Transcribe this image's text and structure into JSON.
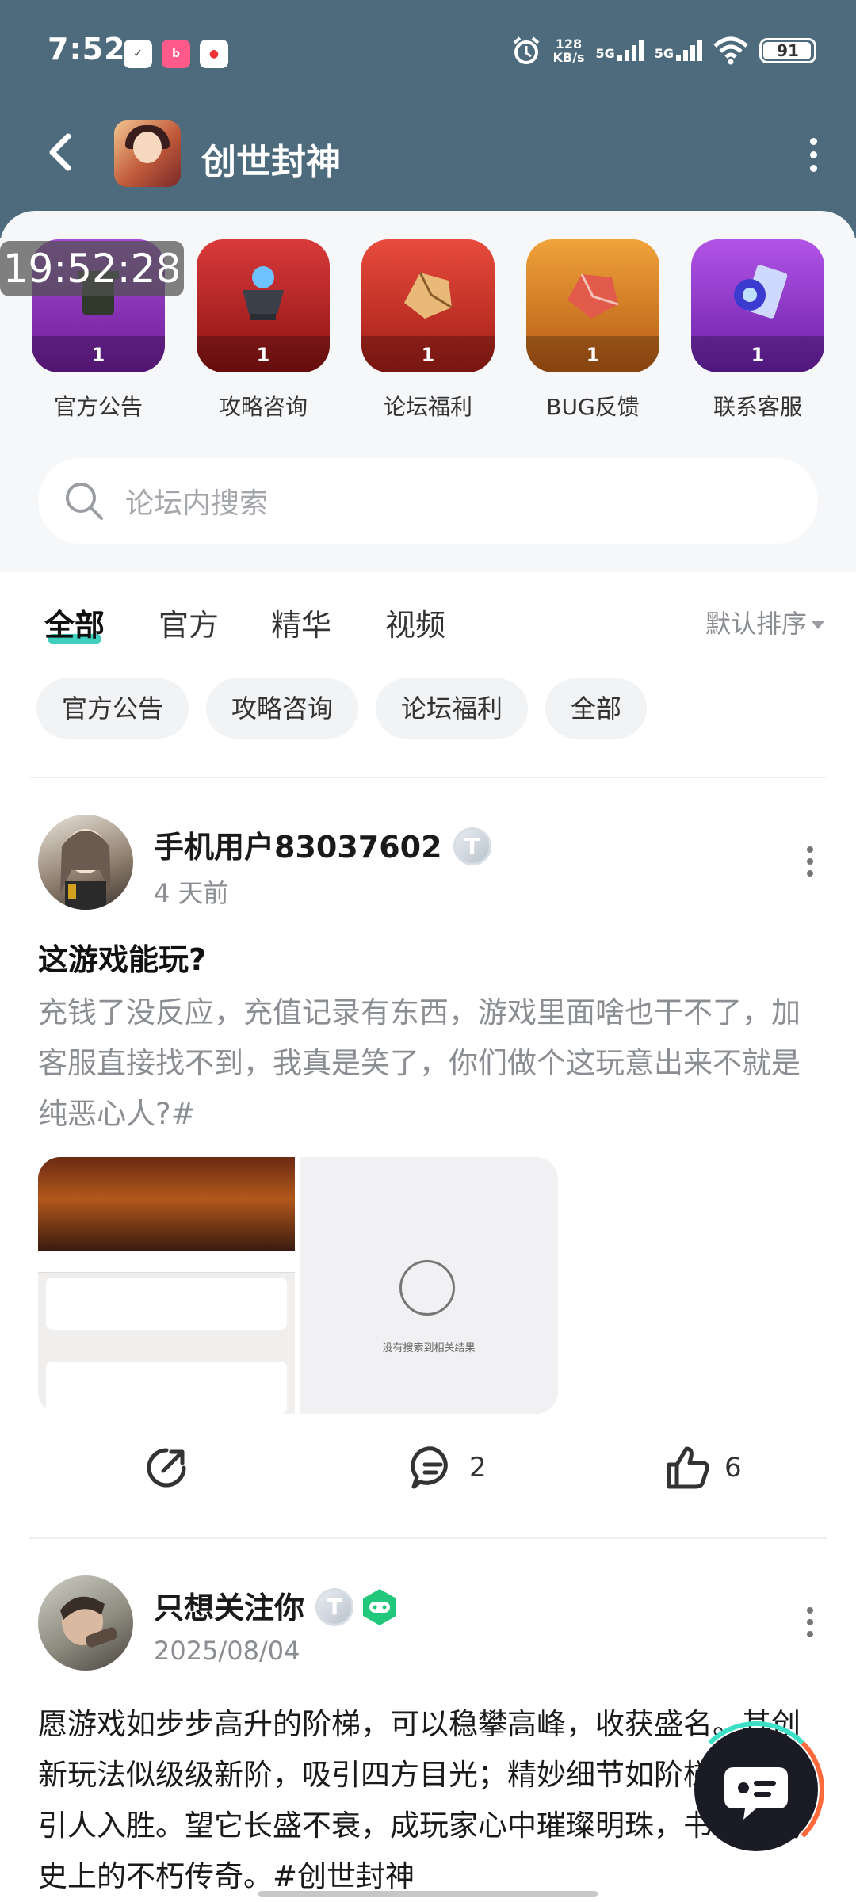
{
  "status_bar": {
    "time": "7:52",
    "net_speed_value": "128",
    "net_speed_unit": "KB/s",
    "signal1": "5G",
    "signal2": "5G",
    "battery": "91"
  },
  "nav": {
    "title": "创世封神"
  },
  "timestamp_overlay": "19:52:28",
  "shortcuts": [
    {
      "label": "官方公告",
      "count": "1"
    },
    {
      "label": "攻略咨询",
      "count": "1"
    },
    {
      "label": "论坛福利",
      "count": "1"
    },
    {
      "label": "BUG反馈",
      "count": "1"
    },
    {
      "label": "联系客服",
      "count": "1"
    }
  ],
  "search": {
    "placeholder": "论坛内搜索"
  },
  "tabs": [
    {
      "label": "全部",
      "active": true
    },
    {
      "label": "官方"
    },
    {
      "label": "精华"
    },
    {
      "label": "视频"
    }
  ],
  "sort_label": "默认排序",
  "chips": [
    "官方公告",
    "攻略咨询",
    "论坛福利",
    "全部"
  ],
  "posts": [
    {
      "username": "手机用户83037602",
      "time": "4 天前",
      "title": "这游戏能玩?",
      "body": "充钱了没反应，充值记录有东西，游戏里面啥也干不了，加客服直接找不到，我真是笑了，你们做个这玩意出来不就是纯恶心人?#",
      "image_b_text": "没有搜索到相关结果",
      "comments": "2",
      "likes": "6"
    },
    {
      "username": "只想关注你",
      "time": "2025/08/04",
      "body": "愿游戏如步步高升的阶梯，可以稳攀高峰，收获盛名。其创新玩法似级级新阶，吸引四方目光；精妙细节如阶梯雕花，引人入胜。望它长盛不衰，成玩家心中璀璨明珠，书写游戏史上的不朽传奇。#创世封神"
    }
  ],
  "badge_letter": "T"
}
